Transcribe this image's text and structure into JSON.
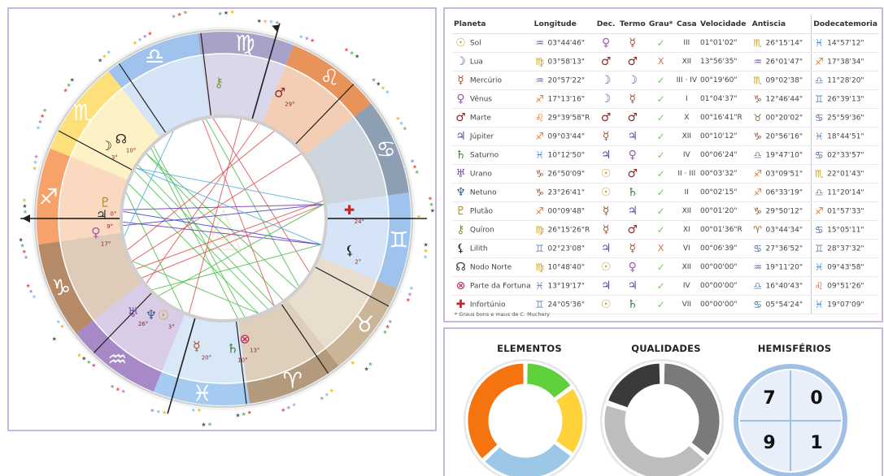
{
  "planet_table": {
    "headers": {
      "planet": "Planeta",
      "longitude": "Longitude",
      "dec": "Dec.",
      "term": "Termo",
      "grade": "Grau*",
      "house": "Casa",
      "velocity": "Velocidade",
      "antiscia": "Antiscia",
      "dodecatemoria": "Dodecatemoria"
    },
    "rows": [
      {
        "pg": "☉",
        "pc": "#c7a43a",
        "name": "Sol",
        "sg": "♒",
        "sc": "#7a55a8",
        "lon": "03°44'46\"",
        "dg": "♀",
        "dc": "#9a5bb0",
        "tg": "☿",
        "tc": "#a0522d",
        "ok": true,
        "house": "III",
        "vel": "01°01'02\"",
        "ag": "♏",
        "ac": "#d4a017",
        "ant": "26°15'14\"",
        "zg": "♓",
        "zc": "#5b8fd1",
        "dod": "14°57'12\""
      },
      {
        "pg": "☽",
        "pc": "#6a5aa8",
        "name": "Lua",
        "sg": "♍",
        "sc": "#d4a017",
        "lon": "03°58'13\"",
        "dg": "♂",
        "dc": "#8a2a2a",
        "tg": "♂",
        "tc": "#8a2a2a",
        "ok": false,
        "house": "XII",
        "vel": "13°56'35\"",
        "ag": "♒",
        "ac": "#7a55a8",
        "ant": "26°01'47\"",
        "zg": "♐",
        "zc": "#e8742a",
        "dod": "17°38'34\""
      },
      {
        "pg": "☿",
        "pc": "#a0522d",
        "name": "Mercúrio",
        "sg": "♒",
        "sc": "#7a55a8",
        "lon": "20°57'22\"",
        "dg": "☽",
        "dc": "#6a5aa8",
        "tg": "☽",
        "tc": "#6a5aa8",
        "ok": true,
        "house": "III · IV",
        "vel": "00°19'60\"",
        "ag": "♏",
        "ac": "#d4a017",
        "ant": "09°02'38\"",
        "zg": "♎",
        "zc": "#5b8fd1",
        "dod": "11°28'20\""
      },
      {
        "pg": "♀",
        "pc": "#9a5bb0",
        "name": "Vênus",
        "sg": "♐",
        "sc": "#e8742a",
        "lon": "17°13'16\"",
        "dg": "☽",
        "dc": "#6a5aa8",
        "tg": "☿",
        "tc": "#a0522d",
        "ok": true,
        "house": "I",
        "vel": "01°04'37\"",
        "ag": "♑",
        "ac": "#8b4c2e",
        "ant": "12°46'44\"",
        "zg": "♊",
        "zc": "#5b8fd1",
        "dod": "26°39'13\""
      },
      {
        "pg": "♂",
        "pc": "#8a2a2a",
        "name": "Marte",
        "sg": "♌",
        "sc": "#d4621e",
        "lon": "29°39'58\"R",
        "dg": "♂",
        "dc": "#8a2a2a",
        "tg": "♂",
        "tc": "#8a2a2a",
        "ok": true,
        "house": "X",
        "vel": "00°16'41\"R",
        "ag": "♉",
        "ac": "#8b6b2e",
        "ant": "00°20'02\"",
        "zg": "♋",
        "zc": "#3d5e8a",
        "dod": "25°59'36\""
      },
      {
        "pg": "♃",
        "pc": "#5a4a9a",
        "name": "Júpiter",
        "sg": "♐",
        "sc": "#e8742a",
        "lon": "09°03'44\"",
        "dg": "☿",
        "dc": "#a0522d",
        "tg": "♃",
        "tc": "#5a4a9a",
        "ok": true,
        "house": "XII",
        "vel": "00°10'12\"",
        "ag": "♑",
        "ac": "#8b4c2e",
        "ant": "20°56'16\"",
        "zg": "♓",
        "zc": "#5b8fd1",
        "dod": "18°44'51\""
      },
      {
        "pg": "♄",
        "pc": "#3a7a3a",
        "name": "Saturno",
        "sg": "♓",
        "sc": "#5b8fd1",
        "lon": "10°12'50\"",
        "dg": "♃",
        "dc": "#5a4a9a",
        "tg": "♀",
        "tc": "#9a5bb0",
        "ok": true,
        "house": "IV",
        "vel": "00°06'24\"",
        "ag": "♎",
        "ac": "#5b8fd1",
        "ant": "19°47'10\"",
        "zg": "♋",
        "zc": "#3d5e8a",
        "dod": "02°33'57\""
      },
      {
        "pg": "♅",
        "pc": "#7a55a8",
        "name": "Urano",
        "sg": "♑",
        "sc": "#8b4c2e",
        "lon": "26°50'09\"",
        "dg": "☉",
        "dc": "#c7a43a",
        "tg": "♂",
        "tc": "#8a2a2a",
        "ok": true,
        "house": "II · III",
        "vel": "00°03'32\"",
        "ag": "♐",
        "ac": "#e8742a",
        "ant": "03°09'51\"",
        "zg": "♏",
        "zc": "#d4a017",
        "dod": "22°01'43\""
      },
      {
        "pg": "♆",
        "pc": "#3d5e8a",
        "name": "Netuno",
        "sg": "♑",
        "sc": "#8b4c2e",
        "lon": "23°26'41\"",
        "dg": "☉",
        "dc": "#c7a43a",
        "tg": "♄",
        "tc": "#3a7a3a",
        "ok": true,
        "house": "II",
        "vel": "00°02'15\"",
        "ag": "♐",
        "ac": "#e8742a",
        "ant": "06°33'19\"",
        "zg": "♎",
        "zc": "#5b8fd1",
        "dod": "11°20'14\""
      },
      {
        "pg": "♇",
        "pc": "#a08a2a",
        "name": "Plutão",
        "sg": "♐",
        "sc": "#e8742a",
        "lon": "00°09'48\"",
        "dg": "☿",
        "dc": "#a0522d",
        "tg": "♃",
        "tc": "#5a4a9a",
        "ok": true,
        "house": "XII",
        "vel": "00°01'20\"",
        "ag": "♑",
        "ac": "#8b4c2e",
        "ant": "29°50'12\"",
        "zg": "♐",
        "zc": "#e8742a",
        "dod": "01°57'33\""
      },
      {
        "pg": "⚷",
        "pc": "#7a9a3a",
        "name": "Quíron",
        "sg": "♍",
        "sc": "#d4a017",
        "lon": "26°15'26\"R",
        "dg": "☿",
        "dc": "#a0522d",
        "tg": "♂",
        "tc": "#8a2a2a",
        "ok": true,
        "house": "XI",
        "vel": "00°01'36\"R",
        "ag": "♈",
        "ac": "#8b6b2e",
        "ant": "03°44'34\"",
        "zg": "♋",
        "zc": "#3d5e8a",
        "dod": "15°05'11\""
      },
      {
        "pg": "⚸",
        "pc": "#222222",
        "name": "Lilith",
        "sg": "♊",
        "sc": "#5b8fd1",
        "lon": "02°23'08\"",
        "dg": "♃",
        "dc": "#5a4a9a",
        "tg": "☿",
        "tc": "#a0522d",
        "ok": false,
        "house": "VI",
        "vel": "00°06'39\"",
        "ag": "♋",
        "ac": "#3d5e8a",
        "ant": "27°36'52\"",
        "zg": "♊",
        "zc": "#5b8fd1",
        "dod": "28°37'32\""
      },
      {
        "pg": "☊",
        "pc": "#333333",
        "name": "Nodo Norte",
        "sg": "♍",
        "sc": "#d4a017",
        "lon": "10°48'40\"",
        "dg": "☉",
        "dc": "#c7a43a",
        "tg": "♀",
        "tc": "#9a5bb0",
        "ok": true,
        "house": "XII",
        "vel": "00°00'00\"",
        "ag": "♒",
        "ac": "#7a55a8",
        "ant": "19°11'20\"",
        "zg": "♓",
        "zc": "#5b8fd1",
        "dod": "09°43'58\""
      },
      {
        "pg": "⊗",
        "pc": "#c2185b",
        "name": "Parte da Fortuna",
        "sg": "♓",
        "sc": "#5b8fd1",
        "lon": "13°19'17\"",
        "dg": "♃",
        "dc": "#5a4a9a",
        "tg": "♃",
        "tc": "#5a4a9a",
        "ok": true,
        "house": "IV",
        "vel": "00°00'00\"",
        "ag": "♎",
        "ac": "#5b8fd1",
        "ant": "16°40'43\"",
        "zg": "♌",
        "zc": "#d4621e",
        "dod": "09°51'26\""
      },
      {
        "pg": "✚",
        "pc": "#c62828",
        "name": "Infortúnio",
        "sg": "♊",
        "sc": "#5b8fd1",
        "lon": "24°05'36\"",
        "dg": "☉",
        "dc": "#c7a43a",
        "tg": "♄",
        "tc": "#3a7a3a",
        "ok": true,
        "house": "VII",
        "vel": "00°00'00\"",
        "ag": "♋",
        "ac": "#3d5e8a",
        "ant": "05°54'24\"",
        "zg": "♓",
        "zc": "#5b8fd1",
        "dod": "19°07'09\""
      }
    ],
    "check_mark": "✓",
    "cross_mark": "X",
    "footnote": "* Graus bons e maus de C. Muchery"
  },
  "stats": {
    "elements_title": "ELEMENTOS",
    "qualities_title": "QUALIDADES",
    "hemispheres_title": "HEMISFÉRIOS",
    "hemispheres": [
      "7",
      "0",
      "9",
      "1"
    ],
    "elements_segments": [
      {
        "element": "fogo",
        "color": "#f5740f",
        "value": 0.37
      },
      {
        "element": "terra",
        "color": "#5fcf3a",
        "value": 0.15
      },
      {
        "element": "ar",
        "color": "#ffd23a",
        "value": 0.2
      },
      {
        "element": "agua",
        "color": "#9cc7e6",
        "value": 0.28
      }
    ],
    "qualities_segments": [
      {
        "quality": "cardinal",
        "color": "#7a7a7a",
        "value": 0.36
      },
      {
        "quality": "fixa",
        "color": "#bdbdbd",
        "value": 0.44
      },
      {
        "quality": "mutavel",
        "color": "#3a3a3a",
        "value": 0.2
      }
    ]
  },
  "wheel": {
    "signs": [
      {
        "glyph": "♈",
        "sign": "aries",
        "color": "#b49a7c",
        "color_in": "#d9c8b3"
      },
      {
        "glyph": "♉",
        "sign": "taurus",
        "color": "#cbb599",
        "color_in": "#e6d9c6"
      },
      {
        "glyph": "♊",
        "sign": "gemini",
        "color": "#9ec3ec",
        "color_in": "#cfe1f6"
      },
      {
        "glyph": "♋",
        "sign": "cancer",
        "color": "#8e9fb3",
        "color_in": "#c5cfda"
      },
      {
        "glyph": "♌",
        "sign": "leo",
        "color": "#e7935a",
        "color_in": "#f3c7a8"
      },
      {
        "glyph": "♍",
        "sign": "virgo",
        "color": "#a7a3c8",
        "color_in": "#d4d1e6"
      },
      {
        "glyph": "♎",
        "sign": "libra",
        "color": "#9fc3ec",
        "color_in": "#cfe1f6"
      },
      {
        "glyph": "♏",
        "sign": "scorpio",
        "color": "#fde07a",
        "color_in": "#fef0bd"
      },
      {
        "glyph": "♐",
        "sign": "sagittarius",
        "color": "#f7a26a",
        "color_in": "#fbd2b6"
      },
      {
        "glyph": "♑",
        "sign": "capricorn",
        "color": "#b68a66",
        "color_in": "#dbc3ae"
      },
      {
        "glyph": "♒",
        "sign": "aquarius",
        "color": "#a889c8",
        "color_in": "#d4c4e3"
      },
      {
        "glyph": "♓",
        "sign": "pisces",
        "color": "#a6cbf0",
        "color_in": "#d2e5f7"
      }
    ],
    "planets": [
      {
        "glyph": "☽",
        "deg": "3°",
        "color": "#2b2b2b"
      },
      {
        "glyph": "☊",
        "deg": "10°",
        "color": "#2b2b2b"
      },
      {
        "glyph": "♇",
        "deg": "0°",
        "color": "#a08a2a"
      },
      {
        "glyph": "♃",
        "deg": "9°",
        "color": "#2b2b2b"
      },
      {
        "glyph": "♀",
        "deg": "17°",
        "color": "#9a5bb0"
      },
      {
        "glyph": "♆",
        "deg": "",
        "color": "#3d5e8a"
      },
      {
        "glyph": "♅",
        "deg": "26°",
        "color": "#7a55a8"
      },
      {
        "glyph": "☉",
        "deg": "3°",
        "color": "#c7a43a"
      },
      {
        "glyph": "☿",
        "deg": "20°",
        "color": "#a0522d"
      },
      {
        "glyph": "♄",
        "deg": "10°",
        "color": "#3a7a3a"
      },
      {
        "glyph": "⊗",
        "deg": "13°",
        "color": "#c2185b"
      },
      {
        "glyph": "✚",
        "deg": "24°",
        "color": "#c62828"
      },
      {
        "glyph": "⚸",
        "deg": "2°",
        "color": "#222222"
      },
      {
        "glyph": "♂",
        "deg": "29°",
        "color": "#8a2a2a"
      },
      {
        "glyph": "⚷",
        "deg": "",
        "color": "#7a9a3a"
      }
    ]
  }
}
